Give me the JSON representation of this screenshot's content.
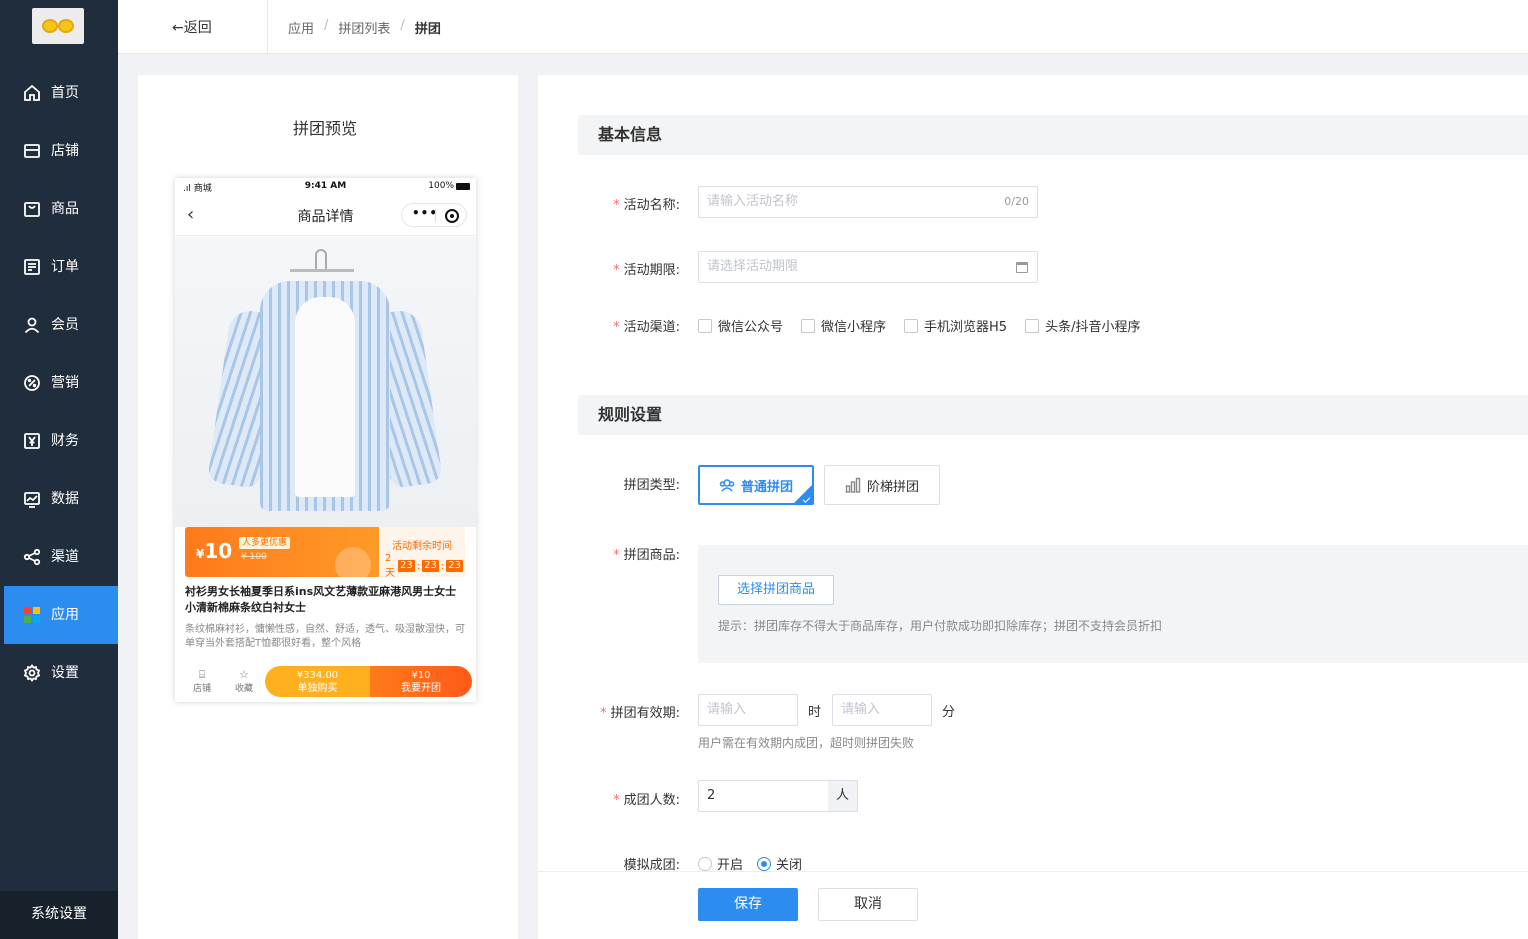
{
  "sidebar": {
    "items": [
      {
        "label": "首页",
        "icon": "home-icon"
      },
      {
        "label": "店铺",
        "icon": "store-icon"
      },
      {
        "label": "商品",
        "icon": "bag-icon"
      },
      {
        "label": "订单",
        "icon": "order-icon"
      },
      {
        "label": "会员",
        "icon": "user-icon"
      },
      {
        "label": "营销",
        "icon": "discount-icon"
      },
      {
        "label": "财务",
        "icon": "yen-icon"
      },
      {
        "label": "数据",
        "icon": "chart-icon"
      },
      {
        "label": "渠道",
        "icon": "share-icon"
      },
      {
        "label": "应用",
        "icon": "apps-icon"
      },
      {
        "label": "设置",
        "icon": "gear-icon"
      }
    ],
    "active": "应用",
    "system_settings": "系统设置"
  },
  "header": {
    "back": "←返回",
    "breadcrumb": [
      "应用",
      "拼团列表",
      "拼团"
    ]
  },
  "preview": {
    "title": "拼团预览",
    "status_left": "商城",
    "status_time": "9:41 AM",
    "status_battery": "100%",
    "nav_title": "商品详情",
    "price_symbol": "¥",
    "price": "10",
    "tag": "人多更优惠",
    "original_price": "¥ 100",
    "remaining_label": "活动剩余时间",
    "countdown": {
      "days": "2天",
      "h": "23",
      "m": "23",
      "s": "23"
    },
    "product_title": "衬衫男女长袖夏季日系ins风文艺薄款亚麻港风男士女士小清新棉麻条纹白衬女士",
    "product_desc": "条纹棉麻衬衫，慵懒性感，自然、舒适，透气、吸湿散湿快，可单穿当外套搭配T恤都很好看，整个风格",
    "footer": {
      "store": "店铺",
      "favorite": "收藏",
      "solo_price": "¥334.00",
      "solo_label": "单独购买",
      "group_price": "¥10",
      "group_label": "我要开团"
    }
  },
  "form": {
    "basic_section": "基本信息",
    "activity_name": {
      "label": "活动名称:",
      "placeholder": "请输入活动名称",
      "counter": "0/20"
    },
    "activity_period": {
      "label": "活动期限:",
      "placeholder": "请选择活动期限"
    },
    "channels": {
      "label": "活动渠道:",
      "options": [
        "微信公众号",
        "微信小程序",
        "手机浏览器H5",
        "头条/抖音小程序"
      ]
    },
    "rules_section": "规则设置",
    "group_type": {
      "label": "拼团类型:",
      "options": [
        "普通拼团",
        "阶梯拼团"
      ],
      "selected": "普通拼团"
    },
    "group_goods": {
      "label": "拼团商品:",
      "button": "选择拼团商品",
      "hint": "提示：拼团库存不得大于商品库存，用户付款成功即扣除库存；拼团不支持会员折扣"
    },
    "validity": {
      "label": "拼团有效期:",
      "hour_placeholder": "请输入",
      "hour_unit": "时",
      "minute_placeholder": "请输入",
      "minute_unit": "分",
      "help": "用户需在有效期内成团，超时则拼团失败"
    },
    "group_size": {
      "label": "成团人数:",
      "value": "2",
      "unit": "人"
    },
    "simulate": {
      "label": "模拟成团:",
      "options": [
        "开启",
        "关闭"
      ],
      "selected": "关闭"
    }
  },
  "actions": {
    "save": "保存",
    "cancel": "取消"
  },
  "colors": {
    "sidebar_bg": "#1f2d3d",
    "accent": "#2d8cf0",
    "orange": "#ff7a1a",
    "required": "#f56c6c"
  }
}
